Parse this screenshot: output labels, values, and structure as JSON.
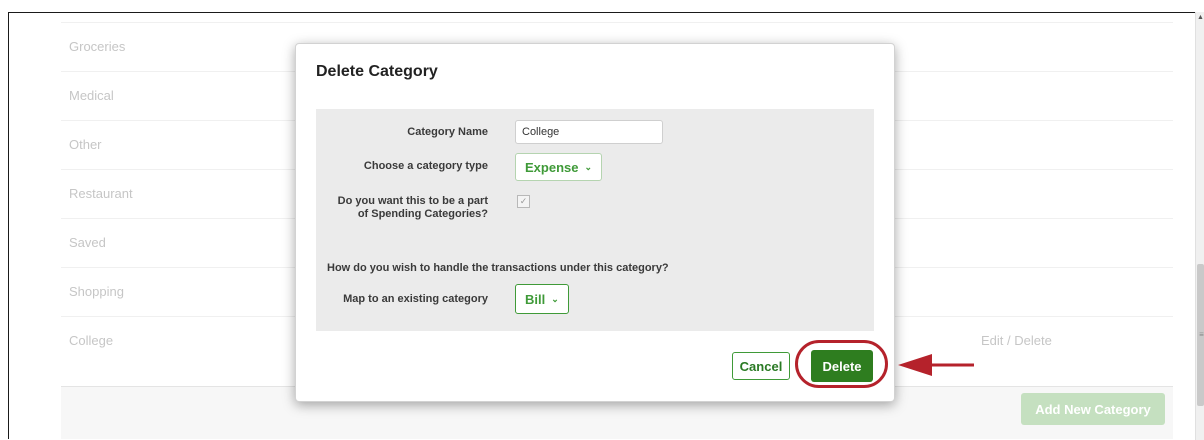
{
  "background": {
    "categories": [
      {
        "name": "Groceries"
      },
      {
        "name": "Medical"
      },
      {
        "name": "Other"
      },
      {
        "name": "Restaurant"
      },
      {
        "name": "Saved"
      },
      {
        "name": "Shopping"
      },
      {
        "name": "College",
        "actions": "Edit / Delete"
      }
    ],
    "add_button": "Add New Category"
  },
  "modal": {
    "title": "Delete Category",
    "category_name_label": "Category Name",
    "category_name_value": "College",
    "category_type_label": "Choose a category type",
    "category_type_value": "Expense",
    "spending_label_line1": "Do you want this to be a part",
    "spending_label_line2": "of Spending Categories?",
    "spending_checked": true,
    "handle_question": "How do you wish to handle the transactions under this category?",
    "map_label": "Map to an existing category",
    "map_value": "Bill",
    "cancel_label": "Cancel",
    "delete_label": "Delete"
  },
  "colors": {
    "accent_green": "#3f9a38",
    "delete_green": "#2e7d1f",
    "annotation_red": "#b5222b"
  },
  "icons": {
    "dropdown": "chevron-down-icon",
    "checkbox": "checkmark-icon",
    "annotation": "arrow-left-icon"
  }
}
